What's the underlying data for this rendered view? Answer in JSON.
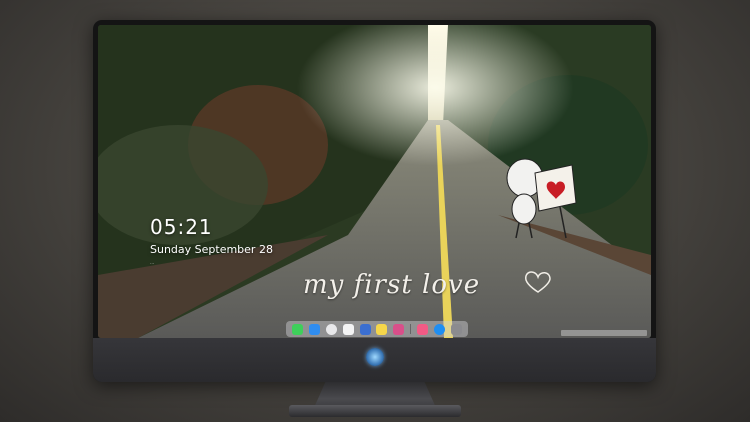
{
  "lockscreen": {
    "time": "05:21",
    "date": "Sunday September  28",
    "notice": "..."
  },
  "wallpaper": {
    "caption": "my first love"
  },
  "dock": {
    "icons": [
      {
        "name": "messages",
        "color": "#3ecf5a"
      },
      {
        "name": "finder",
        "color": "#2f8df0"
      },
      {
        "name": "safari",
        "color": "#e8e8ea"
      },
      {
        "name": "calendar",
        "color": "#f4f4f4"
      },
      {
        "name": "movie",
        "color": "#3b6fd1"
      },
      {
        "name": "notes",
        "color": "#f5d64a"
      },
      {
        "name": "photos",
        "color": "#d94f8a"
      },
      {
        "name": "music",
        "color": "#f25a85"
      },
      {
        "name": "app-store",
        "color": "#1f8ef2"
      },
      {
        "name": "system",
        "color": "#8b8b8f"
      }
    ]
  }
}
